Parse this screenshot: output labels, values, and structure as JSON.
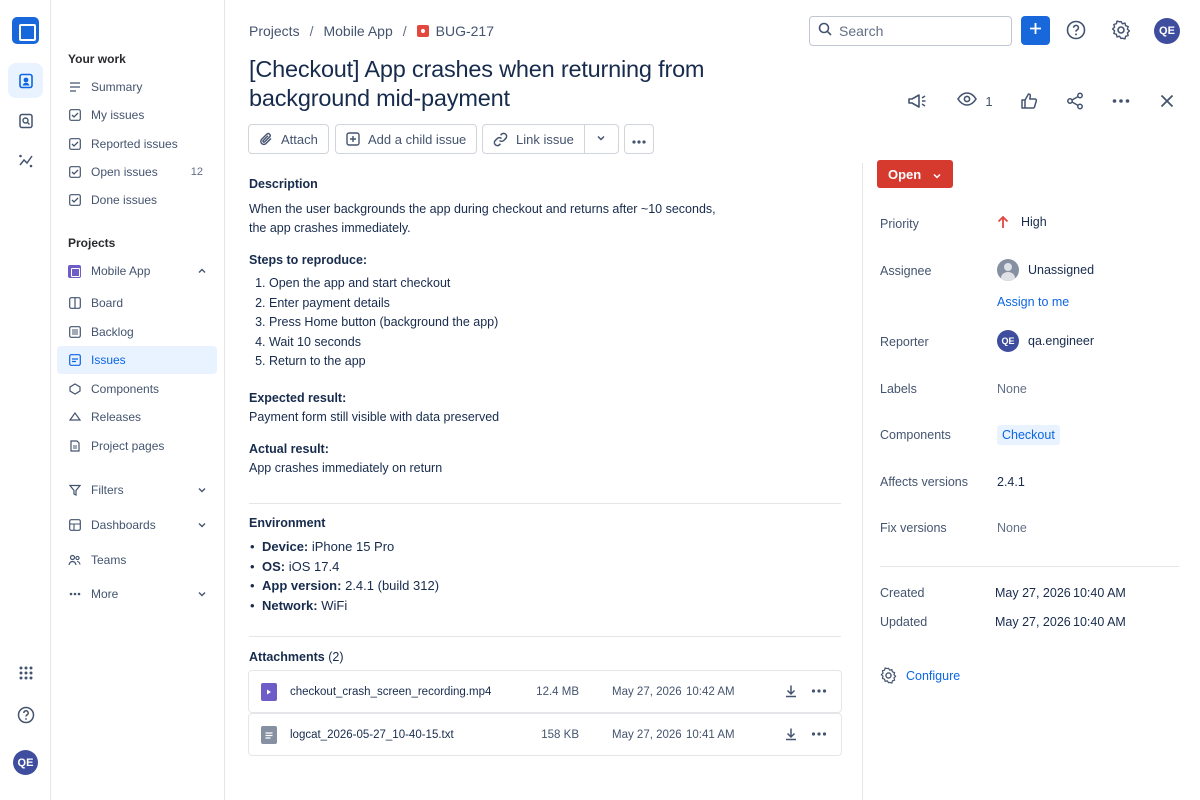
{
  "rail": {
    "avatar_initials": "QE"
  },
  "sidebar": {
    "your_work_heading": "Your work",
    "work_items": [
      {
        "label": "Summary"
      },
      {
        "label": "My issues"
      },
      {
        "label": "Reported issues"
      },
      {
        "label": "Open issues",
        "count": "12"
      },
      {
        "label": "Done issues"
      }
    ],
    "projects_heading": "Projects",
    "project_name": "Mobile App",
    "project_items": [
      {
        "label": "Board"
      },
      {
        "label": "Backlog"
      },
      {
        "label": "Issues"
      },
      {
        "label": "Components"
      },
      {
        "label": "Releases"
      },
      {
        "label": "Project pages"
      }
    ],
    "filters": "Filters",
    "dashboards": "Dashboards",
    "teams": "Teams",
    "more": "More"
  },
  "breadcrumb": {
    "root": "Projects",
    "project": "Mobile App",
    "issue_key": "BUG-217",
    "separator": "/"
  },
  "issue": {
    "title": "[Checkout] App crashes when returning from background mid-payment",
    "watch_count": "1"
  },
  "topbar": {
    "search_placeholder": "Search",
    "avatar_initials": "QE"
  },
  "toolbar": {
    "attach": "Attach",
    "add_child": "Add a child issue",
    "link_issue": "Link issue"
  },
  "description": {
    "heading": "Description",
    "text": "When the user backgrounds the app during checkout and returns after ~10 seconds, the app crashes immediately.",
    "steps_heading": "Steps to reproduce:",
    "steps": [
      "Open the app and start checkout",
      "Enter payment details",
      "Press Home button (background the app)",
      "Wait 10 seconds",
      "Return to the app"
    ],
    "expected_heading": "Expected result:",
    "expected": "Payment form still visible with data preserved",
    "actual_heading": "Actual result:",
    "actual": "App crashes immediately on return"
  },
  "environment": {
    "heading": "Environment",
    "items": [
      {
        "key": "Device:",
        "value": "iPhone 15 Pro"
      },
      {
        "key": "OS:",
        "value": "iOS 17.4"
      },
      {
        "key": "App version:",
        "value": "2.4.1 (build 312)"
      },
      {
        "key": "Network:",
        "value": "WiFi"
      }
    ]
  },
  "attachments": {
    "heading": "Attachments",
    "count": "(2)",
    "files": [
      {
        "name": "checkout_crash_screen_recording.mp4",
        "size": "12.4 MB",
        "date": "May 27, 2026",
        "time": "10:42 AM",
        "icon": "video-file-icon",
        "color": "#6e5dc6"
      },
      {
        "name": "logcat_2026-05-27_10-40-15.txt",
        "size": "158 KB",
        "date": "May 27, 2026",
        "time": "10:41 AM",
        "icon": "text-file-icon",
        "color": "#8590a2"
      }
    ]
  },
  "details": {
    "status": "Open",
    "status_color": "#d63a2f",
    "priority_label": "Priority",
    "priority_value": "High",
    "assignee_label": "Assignee",
    "assignee_value": "Unassigned",
    "assign_to_me": "Assign to me",
    "reporter_label": "Reporter",
    "reporter_initials": "QE",
    "reporter_value": "qa.engineer",
    "labels_label": "Labels",
    "labels_value": "None",
    "components_label": "Components",
    "components_value": "Checkout",
    "affects_label": "Affects versions",
    "affects_value": "2.4.1",
    "fix_label": "Fix versions",
    "fix_value": "None",
    "created_label": "Created",
    "created_date": "May 27, 2026",
    "created_time": "10:40 AM",
    "updated_label": "Updated",
    "updated_date": "May 27, 2026",
    "updated_time": "10:40 AM",
    "configure": "Configure"
  },
  "colors": {
    "accent": "#1868db",
    "link": "#0c66e4",
    "priority_high": "#e2483d"
  }
}
